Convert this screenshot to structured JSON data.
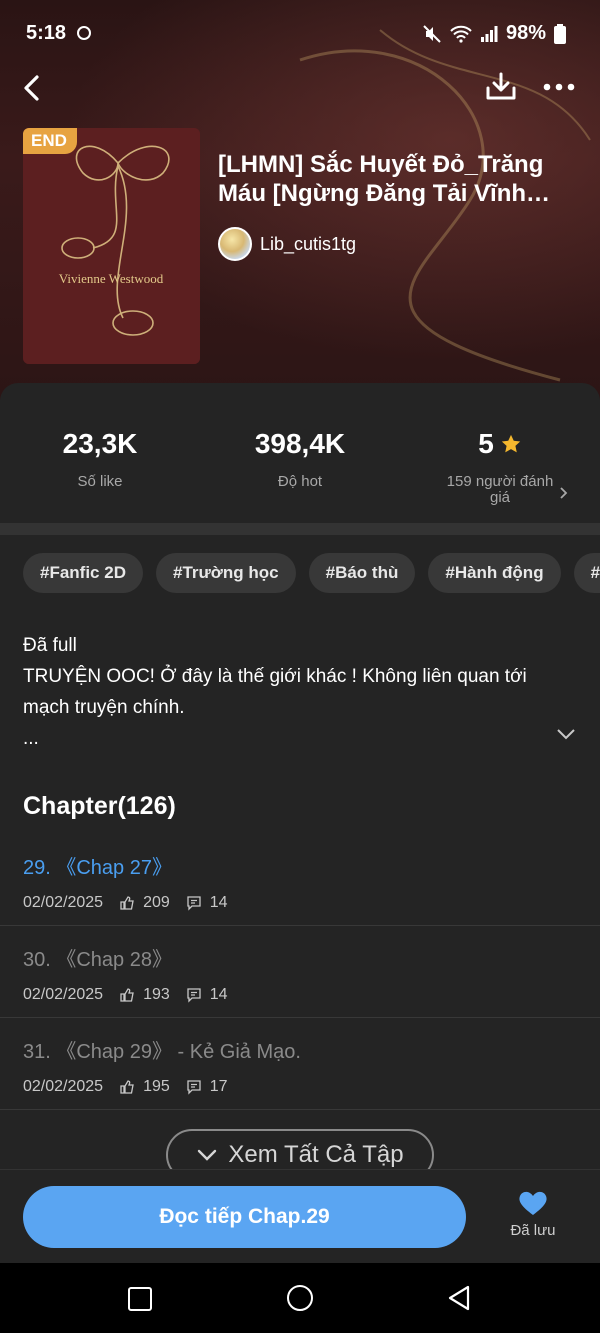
{
  "status": {
    "time": "5:18",
    "battery": "98%"
  },
  "book": {
    "badge": "END",
    "title": "[LHMN] Sắc Huyết Đỏ_Trăng Máu [Ngừng Đăng Tải Vĩnh Viễn]",
    "author": "Lib_cutis1tg",
    "cover_text": "Vivienne Westwood"
  },
  "stats": {
    "likes": {
      "value": "23,3K",
      "label": "Số like"
    },
    "hot": {
      "value": "398,4K",
      "label": "Độ hot"
    },
    "rating": {
      "value": "5",
      "label": "159 người đánh giá"
    }
  },
  "tags": [
    "#Fanfic 2D",
    "#Trường học",
    "#Báo thù",
    "#Hành động",
    "#S"
  ],
  "description": {
    "line1": "Đã full",
    "line2": "TRUYỆN OOC! Ở đây là thế giới khác ! Không liên quan tới mạch truyện chính.",
    "line3": "..."
  },
  "chapters_header": "Chapter(126)",
  "chapters": [
    {
      "title": "29. 《Chap 27》",
      "date": "02/02/2025",
      "likes": "209",
      "comments": "14",
      "active": true
    },
    {
      "title": "30. 《Chap 28》",
      "date": "02/02/2025",
      "likes": "193",
      "comments": "14",
      "active": false
    },
    {
      "title": "31. 《Chap 29》 - Kẻ Giả Mạo.",
      "date": "02/02/2025",
      "likes": "195",
      "comments": "17",
      "active": false
    }
  ],
  "see_all_label": "Xem Tất Cả Tập",
  "read_button_label": "Đọc tiếp Chap.29",
  "saved_label": "Đã lưu",
  "colors": {
    "accent": "#5aa5f2",
    "badge": "#e7a341",
    "star": "#f5b82e"
  },
  "icons": [
    "back-icon",
    "download-icon",
    "more-icon",
    "star-icon",
    "chevron-right-icon",
    "chevron-down-icon",
    "like-icon",
    "comment-icon",
    "heart-icon"
  ]
}
